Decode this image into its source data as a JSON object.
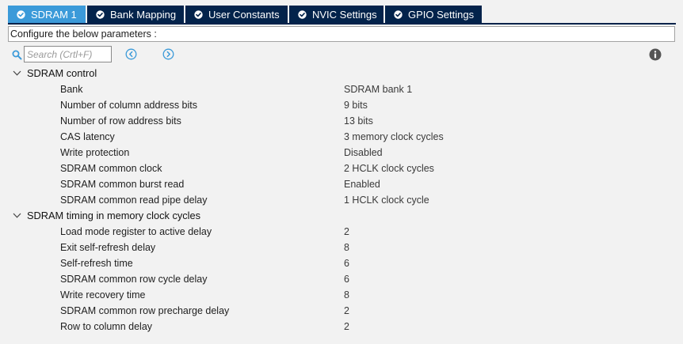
{
  "tabs": [
    {
      "label": "SDRAM 1",
      "active": true
    },
    {
      "label": "Bank Mapping",
      "active": false
    },
    {
      "label": "User Constants",
      "active": false
    },
    {
      "label": "NVIC Settings",
      "active": false
    },
    {
      "label": "GPIO Settings",
      "active": false
    }
  ],
  "description": "Configure the below parameters :",
  "search": {
    "placeholder": "Search (Crtl+F)",
    "value": ""
  },
  "colors": {
    "tab_active": "#3b9ad9",
    "tab_inactive": "#03234b",
    "check_icon": "#ffffff",
    "nav_icon": "#3b9ad9",
    "info_icon": "#555555"
  },
  "icons": {
    "search": "search-icon",
    "prev": "chevron-left-circle-icon",
    "next": "chevron-right-circle-icon",
    "info": "info-icon",
    "group_expanded": "chevron-down-icon",
    "tab_status": "check-circle-icon"
  },
  "groups": [
    {
      "label": "SDRAM control",
      "expanded": true,
      "params": [
        {
          "name": "Bank",
          "value": "SDRAM bank 1"
        },
        {
          "name": "Number of column address bits",
          "value": "9 bits"
        },
        {
          "name": "Number of row address bits",
          "value": "13 bits"
        },
        {
          "name": "CAS latency",
          "value": "3 memory clock cycles"
        },
        {
          "name": "Write protection",
          "value": "Disabled"
        },
        {
          "name": "SDRAM common clock",
          "value": "2 HCLK clock cycles"
        },
        {
          "name": "SDRAM common burst read",
          "value": "Enabled"
        },
        {
          "name": "SDRAM common read pipe delay",
          "value": "1 HCLK clock cycle"
        }
      ]
    },
    {
      "label": "SDRAM timing in memory clock cycles",
      "expanded": true,
      "params": [
        {
          "name": "Load mode register to active delay",
          "value": "2"
        },
        {
          "name": "Exit self-refresh delay",
          "value": "8"
        },
        {
          "name": "Self-refresh time",
          "value": "6"
        },
        {
          "name": "SDRAM common row cycle delay",
          "value": "6"
        },
        {
          "name": "Write recovery time",
          "value": "8"
        },
        {
          "name": "SDRAM common row precharge delay",
          "value": "2"
        },
        {
          "name": "Row to column delay",
          "value": "2"
        }
      ]
    }
  ]
}
